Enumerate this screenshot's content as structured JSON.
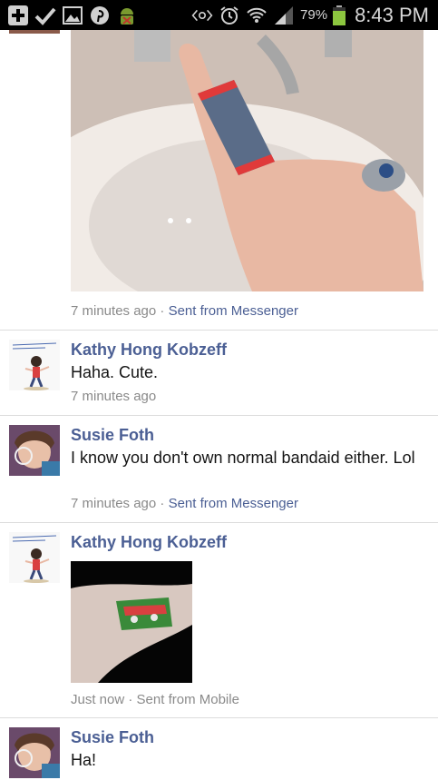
{
  "status_bar": {
    "battery_percent": "79%",
    "battery_level": 0.79,
    "time": "8:43 PM",
    "left_icons": [
      "add-icon",
      "check-icon",
      "gallery-icon",
      "pinterest-icon",
      "android-debug-icon"
    ],
    "right_icons": [
      "nfc-icon",
      "alarm-icon",
      "wifi-icon",
      "signal-icon"
    ]
  },
  "messages": [
    {
      "meta_time": "7 minutes ago",
      "meta_source": "Sent from Messenger",
      "photo": "bandaged-finger-photo"
    },
    {
      "name": "Kathy Hong Kobzeff",
      "text": "Haha. Cute.",
      "meta_time": "7 minutes ago"
    },
    {
      "name": "Susie Foth",
      "text": "I know you don't own normal bandaid either. Lol",
      "meta_time": "7 minutes ago",
      "meta_source": "Sent from Messenger"
    },
    {
      "name": "Kathy Hong Kobzeff",
      "meta_time": "Just now",
      "meta_source": "Sent from Mobile",
      "photo": "bandaged-arm-photo"
    },
    {
      "name": "Susie Foth",
      "text": "Ha!"
    }
  ],
  "separator": "·"
}
